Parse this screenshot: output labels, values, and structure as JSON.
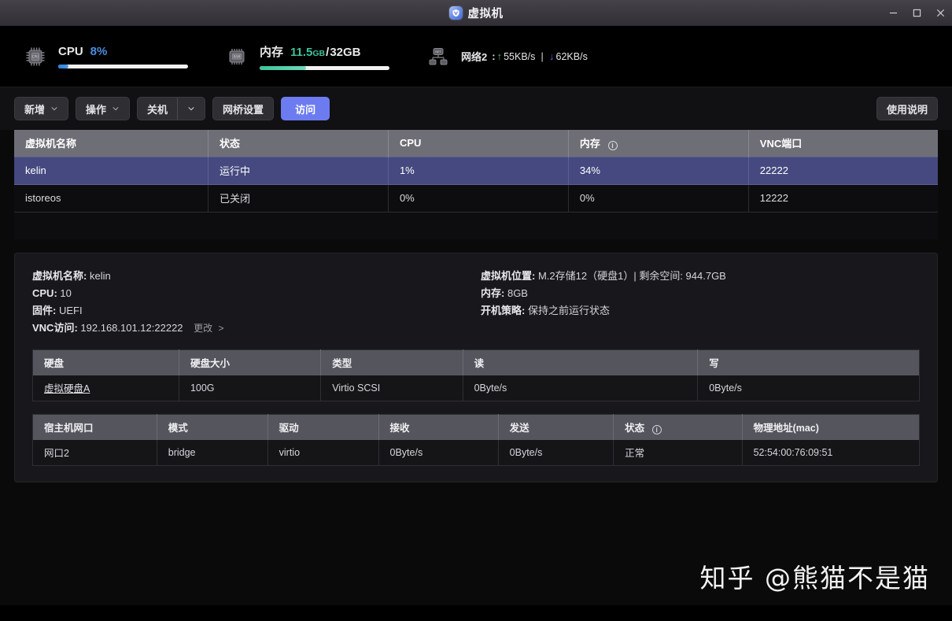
{
  "window": {
    "title": "虚拟机",
    "app_icon": "shield-v-icon",
    "controls": {
      "minimize": "minimize-icon",
      "maximize": "maximize-icon",
      "close": "close-icon"
    }
  },
  "stats": {
    "cpu": {
      "icon": "cpu-chip-icon",
      "label": "CPU",
      "value": "8%",
      "percent": 8,
      "bar_color": "#2f7fd8"
    },
    "memory": {
      "icon": "ram-chip-icon",
      "label": "内存",
      "used": "11.5",
      "used_unit": "GB",
      "separator": "/",
      "total": "32",
      "total_unit": "GB",
      "percent": 36,
      "bar_color": "#3dc49c"
    },
    "network": {
      "icon": "network-icon",
      "label": "网络2",
      "colon": " : ",
      "up_arrow": "↑",
      "up_rate": "55KB/s",
      "pipe": "|",
      "down_arrow": "↓",
      "down_rate": "62KB/s"
    }
  },
  "toolbar": {
    "add": "新增",
    "action": "操作",
    "shutdown": "关机",
    "bridge_settings": "网桥设置",
    "access": "访问",
    "help": "使用说明"
  },
  "vm_table": {
    "columns": [
      "虚拟机名称",
      "状态",
      "CPU",
      "内存",
      "VNC端口"
    ],
    "memory_has_info_icon": true,
    "rows": [
      {
        "name": "kelin",
        "status": "运行中",
        "cpu": "1%",
        "memory": "34%",
        "vnc_port": "22222",
        "selected": true
      },
      {
        "name": "istoreos",
        "status": "已关闭",
        "cpu": "0%",
        "memory": "0%",
        "vnc_port": "12222",
        "selected": false
      }
    ]
  },
  "detail": {
    "left": [
      {
        "key": "虚拟机名称:",
        "value": "kelin"
      },
      {
        "key": "CPU:",
        "value": "10"
      },
      {
        "key": "固件:",
        "value": "UEFI"
      },
      {
        "key": "VNC访问:",
        "value": "192.168.101.12:22222",
        "link": "更改",
        "link_arrow": ">"
      }
    ],
    "right": [
      {
        "key": "虚拟机位置:",
        "value": "M.2存储12（硬盘1）| 剩余空间: 944.7GB"
      },
      {
        "key": "内存:",
        "value": "8GB"
      },
      {
        "key": "开机策略:",
        "value": "保持之前运行状态"
      }
    ]
  },
  "disk_table": {
    "columns": [
      "硬盘",
      "硬盘大小",
      "类型",
      "读",
      "写"
    ],
    "rows": [
      {
        "disk": "虚拟硬盘A",
        "size": "100G",
        "type": "Virtio SCSI",
        "read": "0Byte/s",
        "write": "0Byte/s"
      }
    ]
  },
  "nic_table": {
    "columns": [
      "宿主机网口",
      "模式",
      "驱动",
      "接收",
      "发送",
      "状态",
      "物理地址(mac)"
    ],
    "status_has_info_icon": true,
    "rows": [
      {
        "port": "网口2",
        "mode": "bridge",
        "driver": "virtio",
        "rx": "0Byte/s",
        "tx": "0Byte/s",
        "status": "正常",
        "mac": "52:54:00:76:09:51"
      }
    ]
  },
  "watermark": {
    "text": "知乎 @熊猫不是猫"
  },
  "colors": {
    "accent": "#6c7cf0",
    "selected_row": "#45497f",
    "cpu_bar": "#2f7fd8",
    "mem_bar": "#3dc49c",
    "up": "#3dbf6e",
    "down": "#5a6fd8"
  }
}
